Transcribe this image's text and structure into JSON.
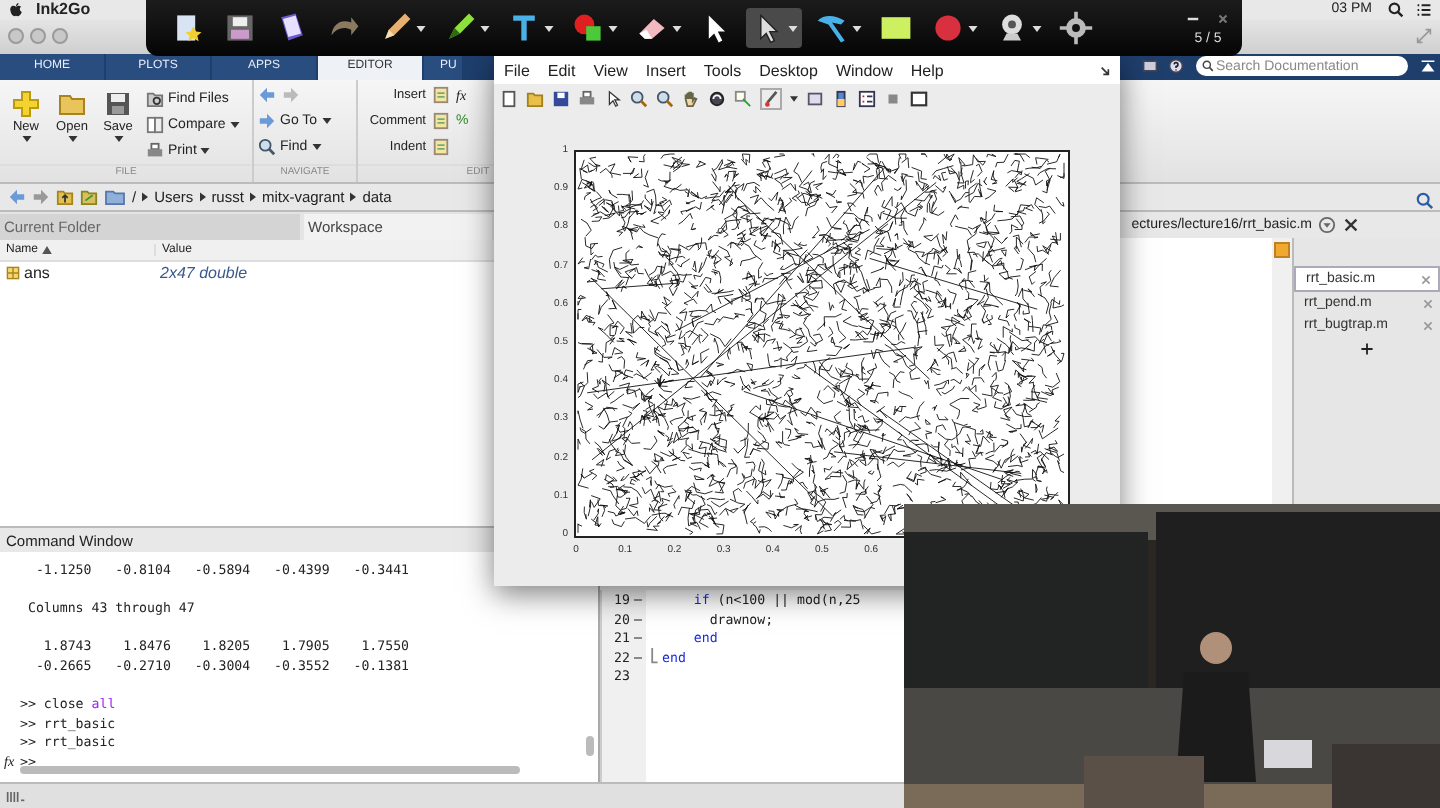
{
  "menubar": {
    "app_name": "Ink2Go",
    "clock": "03 PM"
  },
  "ink_toolbar": {
    "tools": [
      {
        "kind": "star-doc",
        "selected": false,
        "menu": false
      },
      {
        "kind": "floppy",
        "selected": false,
        "menu": false
      },
      {
        "kind": "book",
        "selected": false,
        "menu": false
      },
      {
        "kind": "undo",
        "selected": false,
        "menu": false
      },
      {
        "kind": "pencil",
        "selected": false,
        "menu": true
      },
      {
        "kind": "highlighter",
        "selected": false,
        "menu": true
      },
      {
        "kind": "text",
        "selected": false,
        "menu": true
      },
      {
        "kind": "shapes",
        "selected": false,
        "menu": true
      },
      {
        "kind": "eraser",
        "selected": false,
        "menu": true
      },
      {
        "kind": "arrow",
        "selected": false,
        "menu": false
      },
      {
        "kind": "pointer",
        "selected": true,
        "menu": true
      },
      {
        "kind": "hammer",
        "selected": false,
        "menu": true
      },
      {
        "kind": "swatch",
        "selected": false,
        "menu": false
      },
      {
        "kind": "record",
        "selected": false,
        "menu": true
      },
      {
        "kind": "webcam",
        "selected": false,
        "menu": true
      },
      {
        "kind": "gear",
        "selected": false,
        "menu": false
      }
    ],
    "page_counter": "5 / 5"
  },
  "tabs": [
    {
      "label": "HOME",
      "selected": false
    },
    {
      "label": "PLOTS",
      "selected": false
    },
    {
      "label": "APPS",
      "selected": false
    },
    {
      "label": "EDITOR",
      "selected": true
    },
    {
      "label": "PU",
      "selected": false
    }
  ],
  "search": {
    "placeholder": "Search Documentation"
  },
  "ribbon": {
    "file": {
      "label": "FILE",
      "big": [
        {
          "kind": "new",
          "label": "New"
        },
        {
          "kind": "open",
          "label": "Open"
        },
        {
          "kind": "save",
          "label": "Save"
        }
      ],
      "small": [
        {
          "kind": "find-files",
          "label": "Find Files",
          "menu": false
        },
        {
          "kind": "compare",
          "label": "Compare",
          "menu": true
        },
        {
          "kind": "print",
          "label": "Print",
          "menu": true
        }
      ]
    },
    "navigate": {
      "label": "NAVIGATE",
      "items": [
        {
          "kind": "goto",
          "label": "Go To",
          "menu": true
        },
        {
          "kind": "find",
          "label": "Find",
          "menu": true
        }
      ]
    },
    "edit": {
      "label": "EDIT",
      "rows": [
        {
          "label": "Insert",
          "symbol": "fx"
        },
        {
          "label": "Comment",
          "symbol": "%"
        },
        {
          "label": "Indent"
        }
      ]
    }
  },
  "address": {
    "crumbs": [
      "/",
      "Users",
      "russt",
      "mitx-vagrant",
      "data"
    ]
  },
  "panels": {
    "current_folder": "Current Folder",
    "workspace": "Workspace"
  },
  "workspace": {
    "columns": [
      "Name",
      "Value"
    ],
    "rows": [
      {
        "name": "ans",
        "value": "2x47 double"
      }
    ]
  },
  "command_window": {
    "title": "Command Window",
    "lines": [
      {
        "kind": "output",
        "text": "  -1.1250   -0.8104   -0.5894   -0.4399   -0.3441"
      },
      {
        "kind": "blank"
      },
      {
        "kind": "output",
        "text": " Columns 43 through 47"
      },
      {
        "kind": "blank"
      },
      {
        "kind": "output",
        "text": "   1.8743    1.8476    1.8205    1.7905    1.7550"
      },
      {
        "kind": "output",
        "text": "  -0.2665   -0.2710   -0.3004   -0.3552   -0.1381"
      },
      {
        "kind": "blank"
      },
      {
        "kind": "prompt",
        "prompt": ">>",
        "tokens": [
          {
            "kind": "plain",
            "text": "close "
          },
          {
            "kind": "string",
            "text": "all"
          }
        ]
      },
      {
        "kind": "prompt",
        "prompt": ">>",
        "tokens": [
          {
            "kind": "plain",
            "text": "rrt_basic"
          }
        ]
      },
      {
        "kind": "prompt",
        "prompt": ">>",
        "tokens": [
          {
            "kind": "plain",
            "text": "rrt_basic"
          }
        ]
      },
      {
        "kind": "prompt",
        "prompt": ">>",
        "gutter": "fx"
      }
    ]
  },
  "editor": {
    "path": "ectures/lecture16/rrt_basic.m",
    "lines": [
      {
        "number": "19",
        "dash": true,
        "tokens": [
          {
            "kind": "keyword",
            "text": "    if"
          },
          {
            "kind": "plain",
            "text": " (n<100 || mod(n,25"
          }
        ]
      },
      {
        "number": "20",
        "dash": true,
        "tokens": [
          {
            "kind": "plain",
            "text": "      drawnow;"
          }
        ]
      },
      {
        "number": "21",
        "dash": true,
        "tokens": [
          {
            "kind": "keyword",
            "text": "    end"
          }
        ]
      },
      {
        "number": "22",
        "dash": true,
        "fold_end": true,
        "tokens": [
          {
            "kind": "keyword",
            "text": "end"
          }
        ]
      },
      {
        "number": "23",
        "dash": false
      }
    ],
    "files": [
      {
        "name": "rrt_basic.m",
        "selected": true
      },
      {
        "name": "rrt_pend.m",
        "selected": false
      },
      {
        "name": "rrt_bugtrap.m",
        "selected": false
      }
    ]
  },
  "figure": {
    "menu": [
      "File",
      "Edit",
      "View",
      "Insert",
      "Tools",
      "Desktop",
      "Window",
      "Help"
    ],
    "y_ticks": [
      "1",
      "0.9",
      "0.8",
      "0.7",
      "0.6",
      "0.5",
      "0.4",
      "0.3",
      "0.2",
      "0.1",
      "0"
    ],
    "x_ticks": [
      "0",
      "0.1",
      "0.2",
      "0.3",
      "0.4",
      "0.5",
      "0.6"
    ]
  }
}
